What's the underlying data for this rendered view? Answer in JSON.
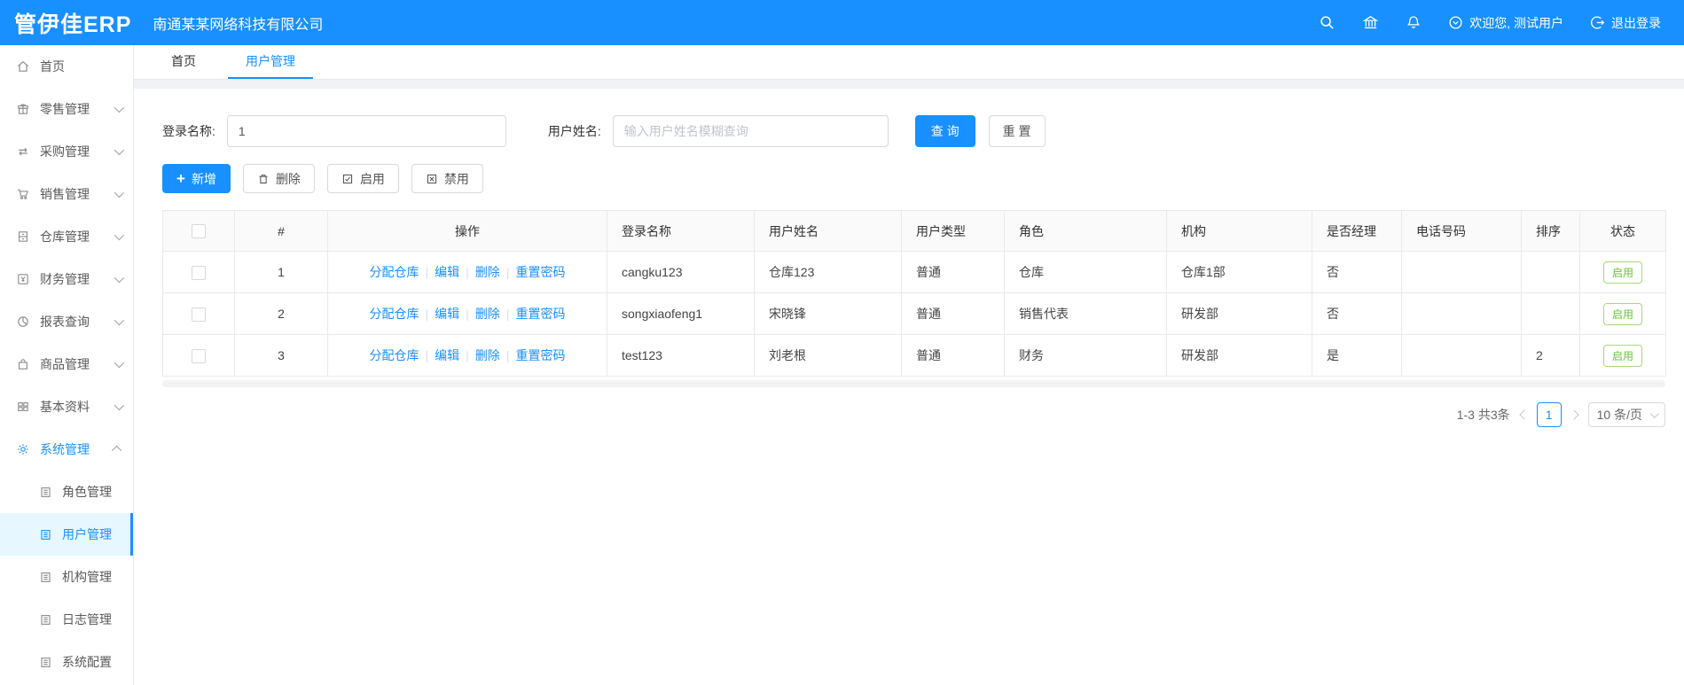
{
  "header": {
    "logo": "管伊佳ERP",
    "company": "南通某某网络科技有限公司",
    "welcome_text": "欢迎您, 测试用户",
    "logout_label": "退出登录",
    "icons": [
      "search-icon",
      "bank-icon",
      "bell-icon",
      "chevron-circle-icon",
      "logout-icon"
    ],
    "accent_color": "#1890ff"
  },
  "sidebar": {
    "items": [
      {
        "label": "首页",
        "icon": "home-icon",
        "expandable": false
      },
      {
        "label": "零售管理",
        "icon": "gift-icon",
        "expandable": true
      },
      {
        "label": "采购管理",
        "icon": "sync-icon",
        "expandable": true
      },
      {
        "label": "销售管理",
        "icon": "cart-icon",
        "expandable": true
      },
      {
        "label": "仓库管理",
        "icon": "cabinet-icon",
        "expandable": true
      },
      {
        "label": "财务管理",
        "icon": "finance-icon",
        "expandable": true
      },
      {
        "label": "报表查询",
        "icon": "pie-chart-icon",
        "expandable": true
      },
      {
        "label": "商品管理",
        "icon": "bag-icon",
        "expandable": true
      },
      {
        "label": "基本资料",
        "icon": "grid-icon",
        "expandable": true
      },
      {
        "label": "系统管理",
        "icon": "gear-icon",
        "expandable": true,
        "expanded": true,
        "active": true
      }
    ],
    "subitems": [
      {
        "label": "角色管理",
        "icon": "document-icon"
      },
      {
        "label": "用户管理",
        "icon": "document-icon",
        "active": true
      },
      {
        "label": "机构管理",
        "icon": "document-icon"
      },
      {
        "label": "日志管理",
        "icon": "document-icon"
      },
      {
        "label": "系统配置",
        "icon": "document-icon"
      }
    ]
  },
  "tabs": [
    {
      "label": "首页",
      "active": false
    },
    {
      "label": "用户管理",
      "active": true
    }
  ],
  "filters": {
    "login_label": "登录名称:",
    "login_value": "1",
    "name_label": "用户姓名:",
    "name_placeholder": "输入用户姓名模糊查询",
    "search_label": "查 询",
    "reset_label": "重 置"
  },
  "toolbar": {
    "add_label": "新增",
    "delete_label": "删除",
    "enable_label": "启用",
    "disable_label": "禁用"
  },
  "table": {
    "columns": {
      "index": "#",
      "actions": "操作",
      "login": "登录名称",
      "name": "用户姓名",
      "type": "用户类型",
      "role": "角色",
      "org": "机构",
      "manager": "是否经理",
      "phone": "电话号码",
      "sort": "排序",
      "status": "状态"
    },
    "row_actions": {
      "assign": "分配仓库",
      "edit": "编辑",
      "delete": "删除",
      "reset_pwd": "重置密码"
    },
    "rows": [
      {
        "index": "1",
        "login": "cangku123",
        "name": "仓库123",
        "type": "普通",
        "role": "仓库",
        "org": "仓库1部",
        "manager": "否",
        "phone": "",
        "sort": "",
        "status": "启用"
      },
      {
        "index": "2",
        "login": "songxiaofeng1",
        "name": "宋晓锋",
        "type": "普通",
        "role": "销售代表",
        "org": "研发部",
        "manager": "否",
        "phone": "",
        "sort": "",
        "status": "启用"
      },
      {
        "index": "3",
        "login": "test123",
        "name": "刘老根",
        "type": "普通",
        "role": "财务",
        "org": "研发部",
        "manager": "是",
        "phone": "",
        "sort": "2",
        "status": "启用"
      }
    ],
    "status_color": "#67c23a"
  },
  "pagination": {
    "total_text": "1-3 共3条",
    "current_page": "1",
    "page_size": "10 条/页"
  }
}
